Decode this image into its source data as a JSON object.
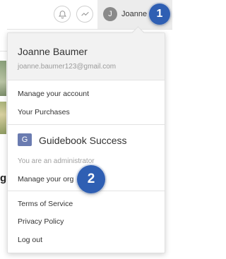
{
  "topbar": {
    "user_initial": "J",
    "user_name": "Joanne"
  },
  "background": {
    "partial_text": "gh"
  },
  "dropdown": {
    "full_name": "Joanne Baumer",
    "email": "joanne.baumer123@gmail.com",
    "account_items": [
      "Manage your account",
      "Your Purchases"
    ],
    "org": {
      "initial": "G",
      "name": "Guidebook Success",
      "admin_note": "You are an administrator",
      "manage_label": "Manage your org"
    },
    "footer_items": [
      "Terms of Service",
      "Privacy Policy",
      "Log out"
    ]
  },
  "callouts": [
    "1",
    "2"
  ],
  "colors": {
    "callout": "#2f5fb3",
    "header_bg": "#f2f2f2",
    "org_icon": "#6a7bb0"
  }
}
